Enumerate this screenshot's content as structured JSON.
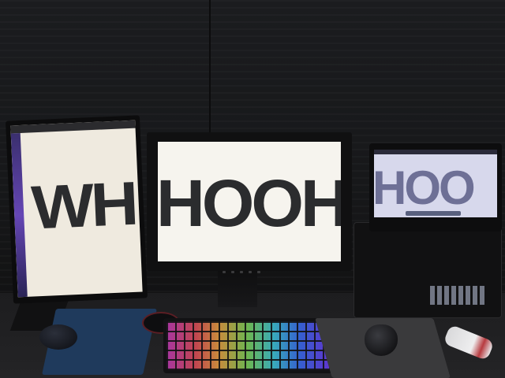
{
  "scene": {
    "description_label": "",
    "left_monitor": {
      "text": "WH"
    },
    "center_monitor": {
      "text": "HOOH"
    },
    "laptop": {
      "text": "HOO"
    }
  },
  "colors": {
    "wall": "#17181a",
    "screen_white": "#f6f4ee",
    "text_dark": "#2b2c2e",
    "laptop_screen": "#d7d8ec",
    "mousepad_blue": "#1f3a5c"
  }
}
